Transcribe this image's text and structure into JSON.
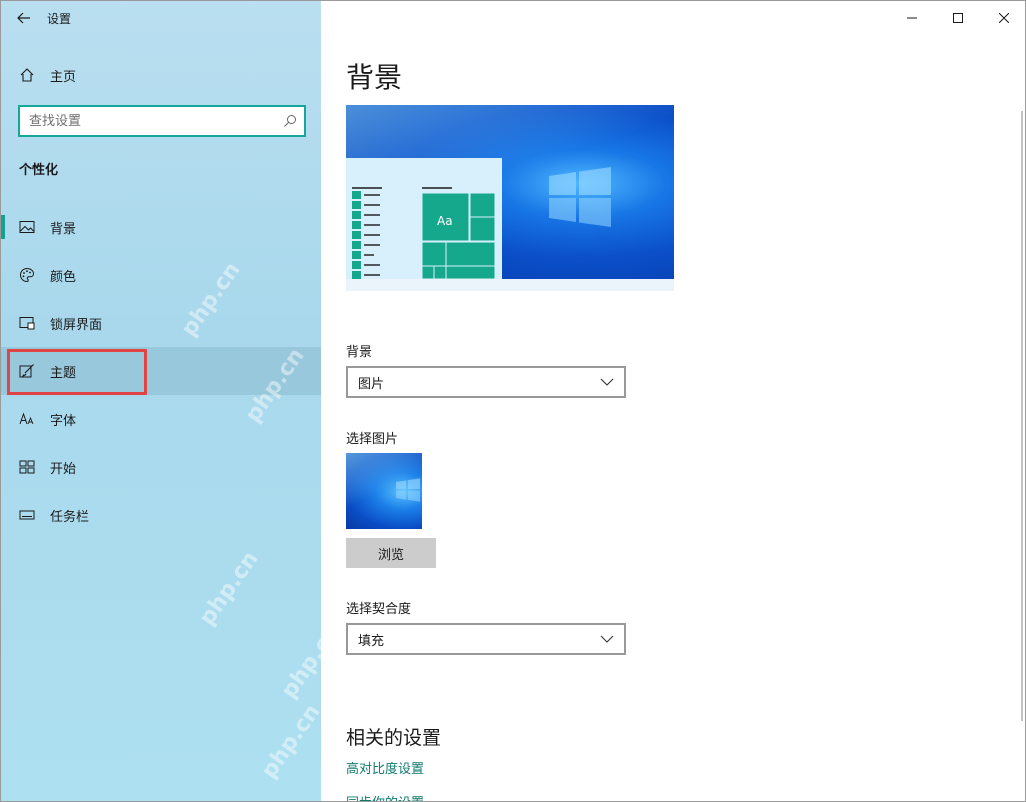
{
  "window": {
    "title": "设置"
  },
  "sidebar": {
    "home_label": "主页",
    "search_placeholder": "查找设置",
    "section_title": "个性化",
    "items": [
      {
        "label": "背景",
        "icon": "image-icon",
        "active": true
      },
      {
        "label": "颜色",
        "icon": "palette-icon"
      },
      {
        "label": "锁屏界面",
        "icon": "lock-screen-icon"
      },
      {
        "label": "主题",
        "icon": "theme-brush-icon",
        "hovered": true
      },
      {
        "label": "字体",
        "icon": "font-icon"
      },
      {
        "label": "开始",
        "icon": "start-grid-icon"
      },
      {
        "label": "任务栏",
        "icon": "taskbar-icon"
      }
    ]
  },
  "main": {
    "page_title": "背景",
    "preview_tile_text": "Aa",
    "background_label": "背景",
    "background_value": "图片",
    "choose_picture_label": "选择图片",
    "browse_label": "浏览",
    "fit_label": "选择契合度",
    "fit_value": "填充",
    "related_title": "相关的设置",
    "links": [
      "高对比度设置",
      "同步你的设置"
    ]
  },
  "watermark_text": "php.cn",
  "colors": {
    "accent": "#18a08f",
    "link": "#117a6f",
    "highlight": "#e04444"
  }
}
